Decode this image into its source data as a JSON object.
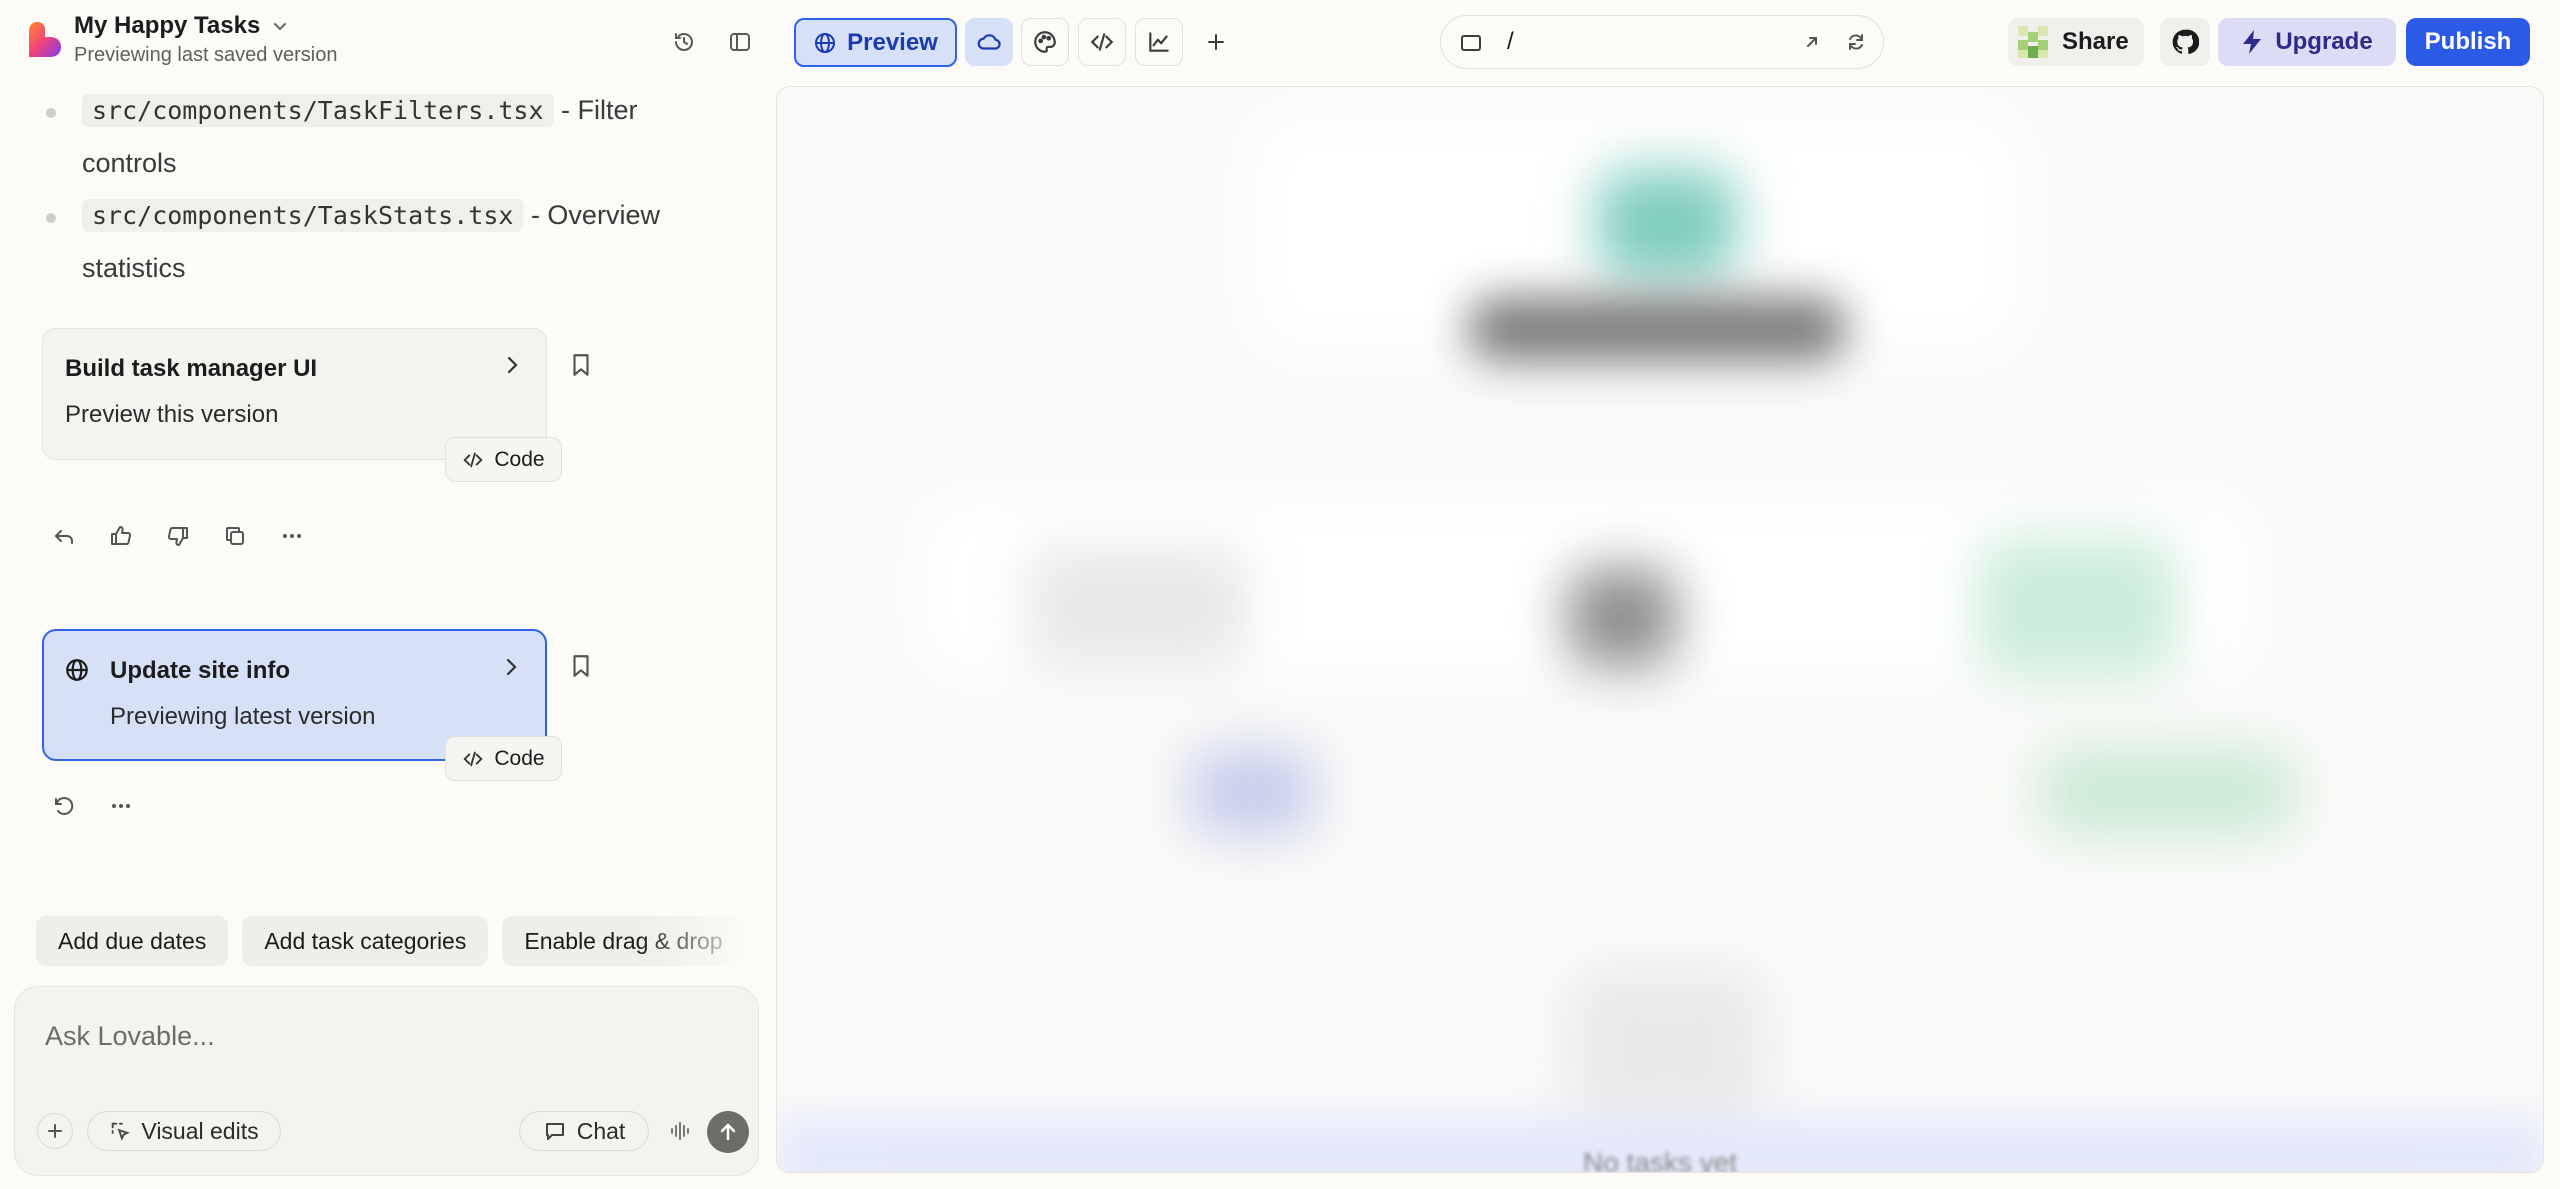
{
  "header": {
    "project_title": "My Happy Tasks",
    "project_subtitle": "Previewing last saved version",
    "preview_label": "Preview",
    "url_path": "/",
    "share_label": "Share",
    "upgrade_label": "Upgrade",
    "publish_label": "Publish"
  },
  "chat": {
    "files": [
      {
        "path": "src/components/TaskFilters.tsx",
        "desc_line1": " - Filter",
        "desc_line2": "controls"
      },
      {
        "path": "src/components/TaskStats.tsx",
        "desc_line1": " - Overview",
        "desc_line2": "statistics"
      }
    ],
    "cards": [
      {
        "title": "Build task manager UI",
        "subtitle": "Preview this version",
        "code_label": "Code"
      },
      {
        "title": "Update site info",
        "subtitle": "Previewing latest version",
        "code_label": "Code"
      }
    ],
    "suggestions": [
      "Add due dates",
      "Add task categories",
      "Enable drag & drop"
    ]
  },
  "composer": {
    "placeholder": "Ask Lovable...",
    "visual_edits_label": "Visual edits",
    "chat_label": "Chat"
  },
  "preview": {
    "empty_text": "No tasks yet"
  },
  "colors": {
    "accent": "#2a5ae6",
    "active_card_bg": "#d6e1f8",
    "upgrade_bg": "#dcdcf5",
    "page_bg": "#fcfbf8"
  }
}
